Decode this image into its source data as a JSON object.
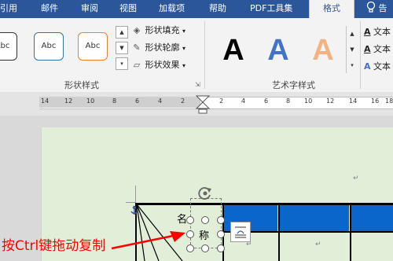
{
  "ribbon": {
    "tabs": [
      "引用",
      "邮件",
      "审阅",
      "视图",
      "加载项",
      "帮助",
      "PDF工具集",
      "格式"
    ],
    "active_tab": "格式",
    "tell_me_icon": "lightbulb-icon",
    "tell_me_text": "告",
    "shape_styles": {
      "thumbnails": [
        "Abc",
        "Abc",
        "Abc"
      ],
      "colors": [
        "#333333",
        "#2e75b6",
        "#ed7d31"
      ],
      "commands": [
        {
          "icon": "fill-bucket-icon",
          "label": "形状填充"
        },
        {
          "icon": "pen-outline-icon",
          "label": "形状轮廓"
        },
        {
          "icon": "shape-effects-icon",
          "label": "形状效果"
        }
      ],
      "group_label": "形状样式"
    },
    "wordart_styles": {
      "letters": [
        "A",
        "A",
        "A"
      ],
      "colors": [
        "#000000",
        "#4472c4",
        "#f4b183"
      ],
      "group_label": "艺术字样式",
      "text_commands": [
        "文本",
        "文本",
        "文本"
      ]
    }
  },
  "ruler": {
    "ticks_left": [
      "14",
      "12",
      "10",
      "8",
      "6",
      "4",
      "2"
    ],
    "ticks_right": [
      "2",
      "4",
      "6",
      "8",
      "10",
      "12",
      "14",
      "16",
      "18"
    ]
  },
  "document": {
    "paragraph_mark": "↵",
    "textbox_text_1": "名",
    "textbox_text_2": "称",
    "header_fill": "#0b66cc"
  },
  "annotation": {
    "text": "按Ctrl键拖动复制",
    "color": "#ff0000"
  }
}
